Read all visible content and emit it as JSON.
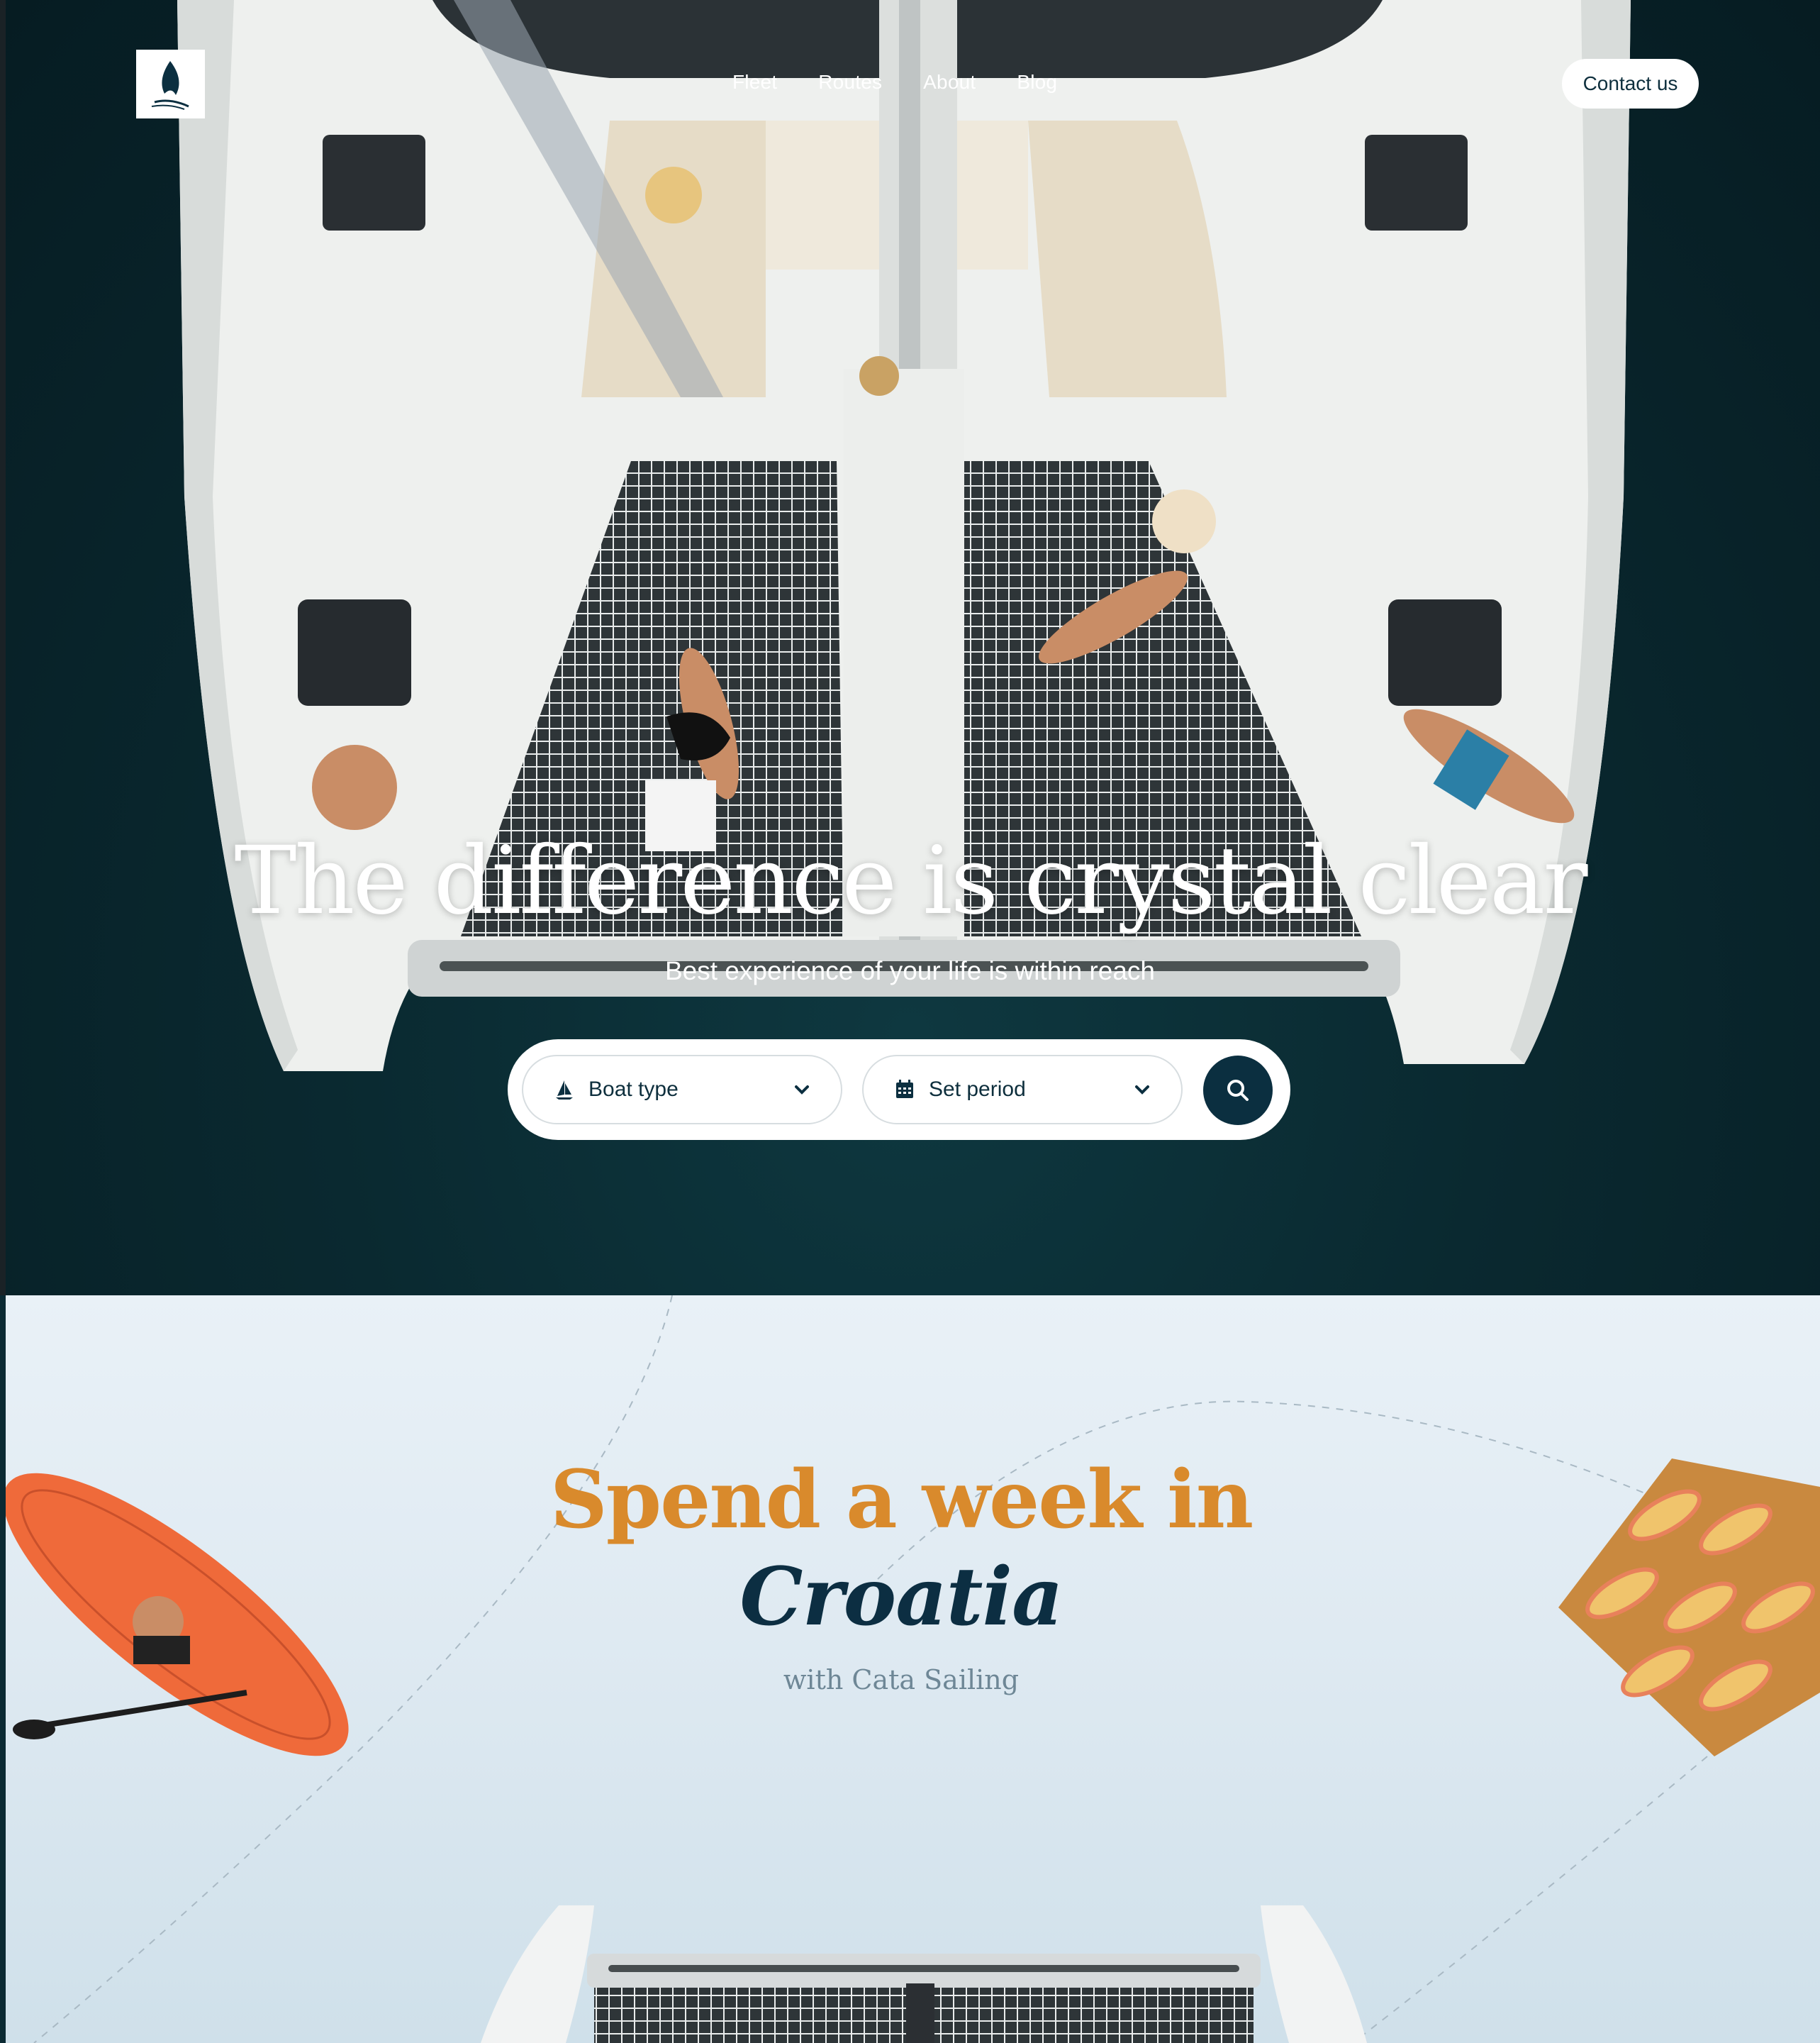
{
  "nav": {
    "links": [
      "Fleet",
      "Routes",
      "About",
      "Blog"
    ],
    "contact_label": "Contact us"
  },
  "hero": {
    "title": "The difference is crystal clear",
    "subtitle": "Best experience of your life is within reach"
  },
  "search": {
    "boat_type": {
      "label": "Boat type",
      "icon": "sailboat-icon"
    },
    "period": {
      "label": "Set period",
      "icon": "calendar-icon"
    },
    "submit_icon": "search-icon"
  },
  "section2": {
    "line1": "Spend a week in",
    "line2": "Croatia",
    "subtitle": "with Cata Sailing"
  },
  "colors": {
    "accent_orange": "#d98a2c",
    "navy": "#0b2f40",
    "sea": "#0a2930",
    "section_bg": "#e4eef5"
  }
}
